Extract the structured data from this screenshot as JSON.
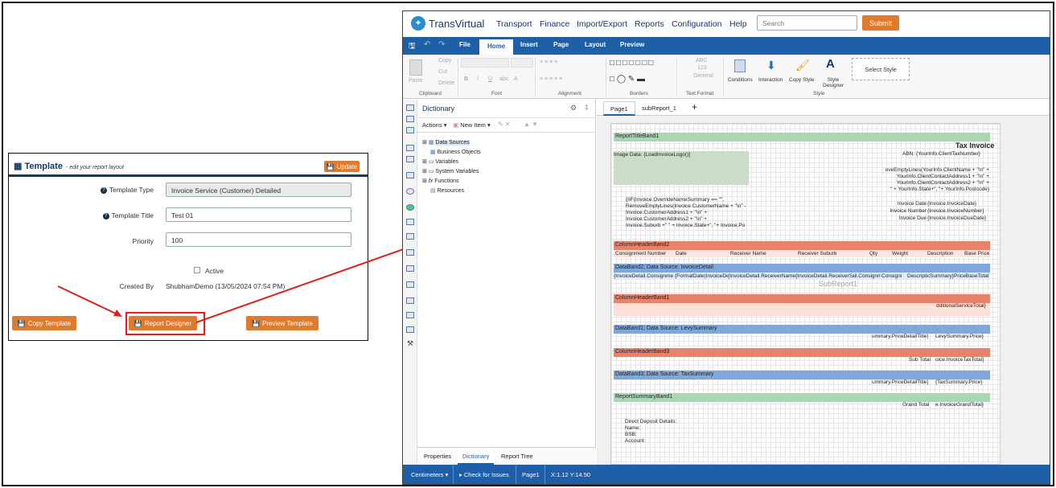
{
  "template_panel": {
    "title": "Template",
    "subtitle": "- edit your report layout",
    "update_label": "Update",
    "fields": [
      {
        "label": "Template Type",
        "value": "Invoice Service (Customer) Detailed",
        "help": true
      },
      {
        "label": "Template Title",
        "value": "Test 01",
        "help": true
      },
      {
        "label": "Priority",
        "value": "100",
        "help": false
      }
    ],
    "active_label": "Active",
    "created_by_label": "Created By",
    "created_by_value": "ShubhamDemo (13/05/2024 07:54 PM)",
    "buttons": {
      "copy": "Copy Template",
      "designer": "Report Designer",
      "preview": "Preview Template"
    }
  },
  "app": {
    "brand": "TransVirtual",
    "nav": [
      "Transport",
      "Finance",
      "Import/Export",
      "Reports",
      "Configuration",
      "Help"
    ],
    "search_placeholder": "Search",
    "submit_label": "Submit",
    "ribbon_tabs": [
      "File",
      "Home",
      "Insert",
      "Page",
      "Layout",
      "Preview"
    ],
    "ribbon": {
      "paste": "Paste",
      "copy": "Copy",
      "cut": "Cut",
      "delete": "Delete",
      "groups": [
        "Clipboard",
        "Font",
        "Alignment",
        "Borders",
        "Text Format",
        "Style"
      ],
      "general": "General",
      "abc": "ABC",
      "nums": "123",
      "conditions": "Conditions",
      "interaction": "Interaction",
      "copy_style": "Copy Style",
      "style_designer": "Style Designer",
      "select_style": "Select Style"
    },
    "dictionary": {
      "title": "Dictionary",
      "actions": "Actions",
      "new_item": "New Item",
      "tree": [
        "Data Sources",
        "Business Objects",
        "Variables",
        "System Variables",
        "Functions",
        "Resources"
      ],
      "tabs": [
        "Properties",
        "Dictionary",
        "Report Tree"
      ]
    },
    "page_tabs": [
      "Page1",
      "subReport_1",
      "+"
    ],
    "status": {
      "units": "Centimeters",
      "check": "Check for Issues",
      "page": "Page1",
      "coords": "X:1.12 Y:14.50"
    },
    "report": {
      "report_title_band": "ReportTitleBand1",
      "tax_invoice": "Tax Invoice",
      "abn": "ABN: {YourInfo.ClientTaxNumber}",
      "image_data": "Image Data: {LoadInvoiceLogo()}",
      "address_block": [
        "oveEmptyLines(YourInfo.ClientName + \"\\n\" +",
        "YourInfo.ClientContactAddress1 + \"\\n\" +",
        "YourInfo.ClientContactAddress2 + \"\\n\" +",
        "\" + YourInfo.State+\", \"+ YourInfo.Postcode)"
      ],
      "customer_block": [
        "{IIF(Invoice.OverrideNameSummary == \"\",",
        "RemoveEmptyLines(Invoice.CustomerName + \"\\n\" -",
        "Invoice.CustomerAddress1 + \"\\n\" +",
        "Invoice.CustomerAddress2 + \"\\n\" +",
        "Invoice.Suburb +\" \" + Invoice.State+\", \"+ Invoice.Po"
      ],
      "invoice_date": "Invoice Date",
      "invoice_date_val": "{Invoice.InvoiceDate}",
      "invoice_number": "Invoice Number",
      "invoice_number_val": "{Invoice.InvoiceNumber}",
      "invoice_due": "Invoice Due",
      "invoice_due_val": "{Invoice.InvoiceDueDate}",
      "column_header_band2": "ColumnHeaderBand2",
      "columns": [
        "Consignment Number",
        "Date",
        "Receiver Name",
        "Receiver Suburb",
        "Qty",
        "Weight",
        "Description",
        "Base Price"
      ],
      "databand2": "DataBand2; Data Source: InvoiceDetail",
      "databand2_fields": [
        "{InvoiceDetail.Consignme",
        "{FormatDate(InvoiceDe",
        "{InvoiceDetail.ReceiverName}",
        "{InvoiceDetail.ReceiverSub",
        "ail.Consignm",
        "Consigni",
        "Description",
        "Summary}",
        "PriceBaseTotal}"
      ],
      "subreport": "SubReport1",
      "column_header_band1": "ColumnHeaderBand1",
      "additional_total": "dditionalServiceTotal}",
      "databand1": "DataBand1; Data Source: LevySummary",
      "levy_title": "ummary.PriceDetailTitle}",
      "levy_price": "LevySummary.Price}",
      "column_header_band3": "ColumnHeaderBand3",
      "sub_total": "Sub Total",
      "sub_total_val": "oice.InvoiceTaxTotal}",
      "databand3": "DataBand3; Data Source: TaxSummary",
      "tax_title": "ummary.PriceDetailTitle}",
      "tax_price": "{TaxSummary.Price}",
      "summary_band": "ReportSummaryBand1",
      "grand_total": "Grand Total",
      "grand_total_val": "e.InvoiceGrandTotal}",
      "deposit": [
        "Direct Deposit Details:",
        "Name:",
        "BSB:",
        "Account:"
      ]
    }
  },
  "colors": {
    "orange": "#e07a2c",
    "navy": "#17376a",
    "ribbon": "#1f5fa8",
    "arrow": "#e02020"
  }
}
